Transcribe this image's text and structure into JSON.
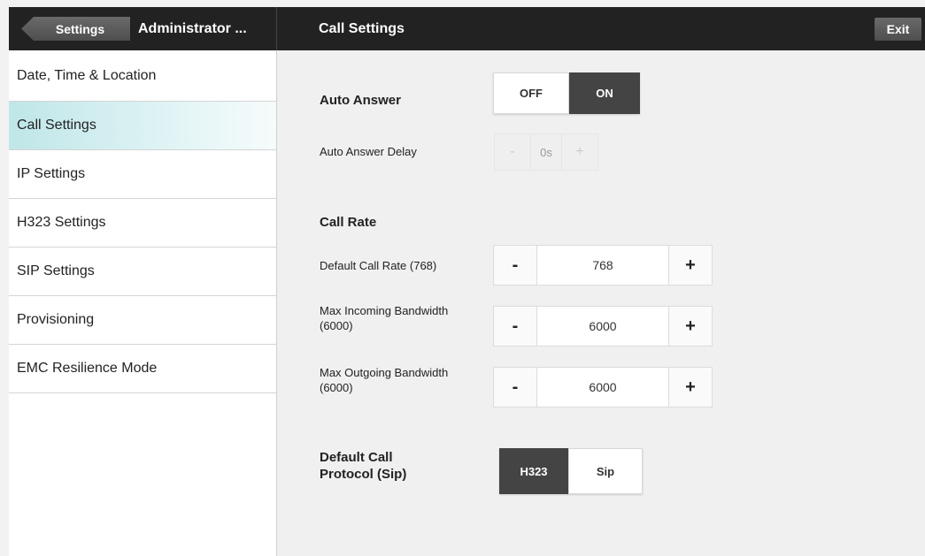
{
  "header": {
    "back_label": "Settings",
    "admin_title": "Administrator ...",
    "page_title": "Call Settings",
    "exit_label": "Exit"
  },
  "sidebar": {
    "items": [
      {
        "label": "Date, Time & Location"
      },
      {
        "label": "Call Settings",
        "active": true
      },
      {
        "label": "IP Settings"
      },
      {
        "label": "H323 Settings"
      },
      {
        "label": "SIP Settings"
      },
      {
        "label": "Provisioning"
      },
      {
        "label": "EMC Resilience Mode"
      }
    ]
  },
  "auto_answer": {
    "label": "Auto Answer",
    "off_label": "OFF",
    "on_label": "ON",
    "selected": "ON",
    "delay": {
      "label": "Auto Answer Delay",
      "minus": "-",
      "value": "0s",
      "plus": "+",
      "enabled": false
    }
  },
  "call_rate": {
    "section_label": "Call Rate",
    "default_rate": {
      "label": "Default Call Rate (768)",
      "minus": "-",
      "value": "768",
      "plus": "+"
    },
    "max_incoming": {
      "label": "Max Incoming Bandwidth (6000)",
      "minus": "-",
      "value": "6000",
      "plus": "+"
    },
    "max_outgoing": {
      "label": "Max Outgoing Bandwidth (6000)",
      "minus": "-",
      "value": "6000",
      "plus": "+"
    }
  },
  "protocol": {
    "label": "Default Call Protocol (Sip)",
    "options": [
      "H323",
      "Sip"
    ],
    "selected": "H323"
  },
  "colors": {
    "header_bg": "#222222",
    "active_item": "#bfe6e8",
    "toggle_on": "#444444"
  }
}
